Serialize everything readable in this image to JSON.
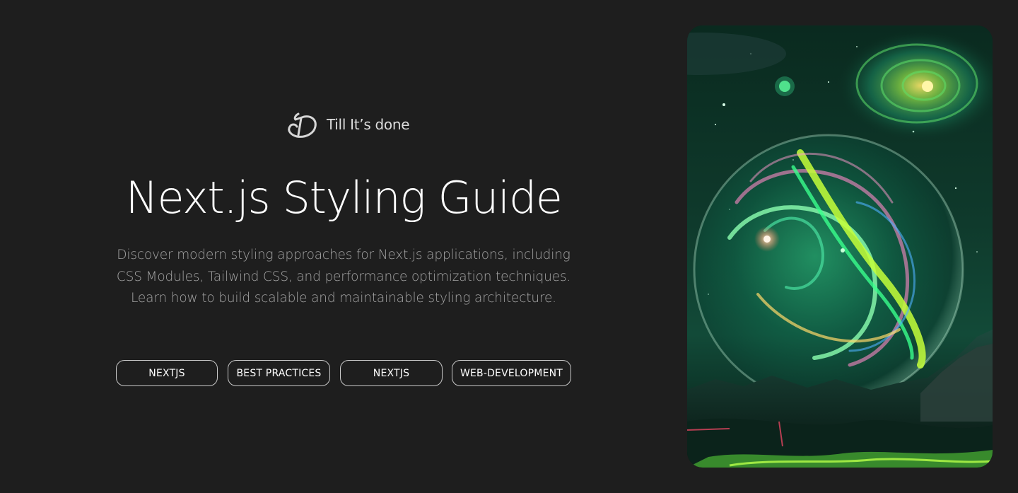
{
  "brand": {
    "name": "Till It’s done",
    "logo_icon": "td-monogram-icon"
  },
  "hero": {
    "title": "Next.js Styling Guide",
    "description_lines": [
      "Discover modern styling approaches for Next.js applications, including",
      "CSS Modules, Tailwind CSS, and performance optimization techniques.",
      "Learn how to build scalable and maintainable styling architecture."
    ]
  },
  "tags": [
    {
      "label": "NEXTJS"
    },
    {
      "label": "BEST PRACTICES"
    },
    {
      "label": "NEXTJS"
    },
    {
      "label": "WEB-DEVELOPMENT"
    }
  ],
  "image": {
    "subject": "cosmic-green-orb-artwork-icon"
  },
  "colors": {
    "background": "#1e1e1e",
    "title": "#ffffff",
    "description": "#a4a4a4",
    "tag_border": "#c9c9c9",
    "accent_green": "#3ee07a"
  }
}
